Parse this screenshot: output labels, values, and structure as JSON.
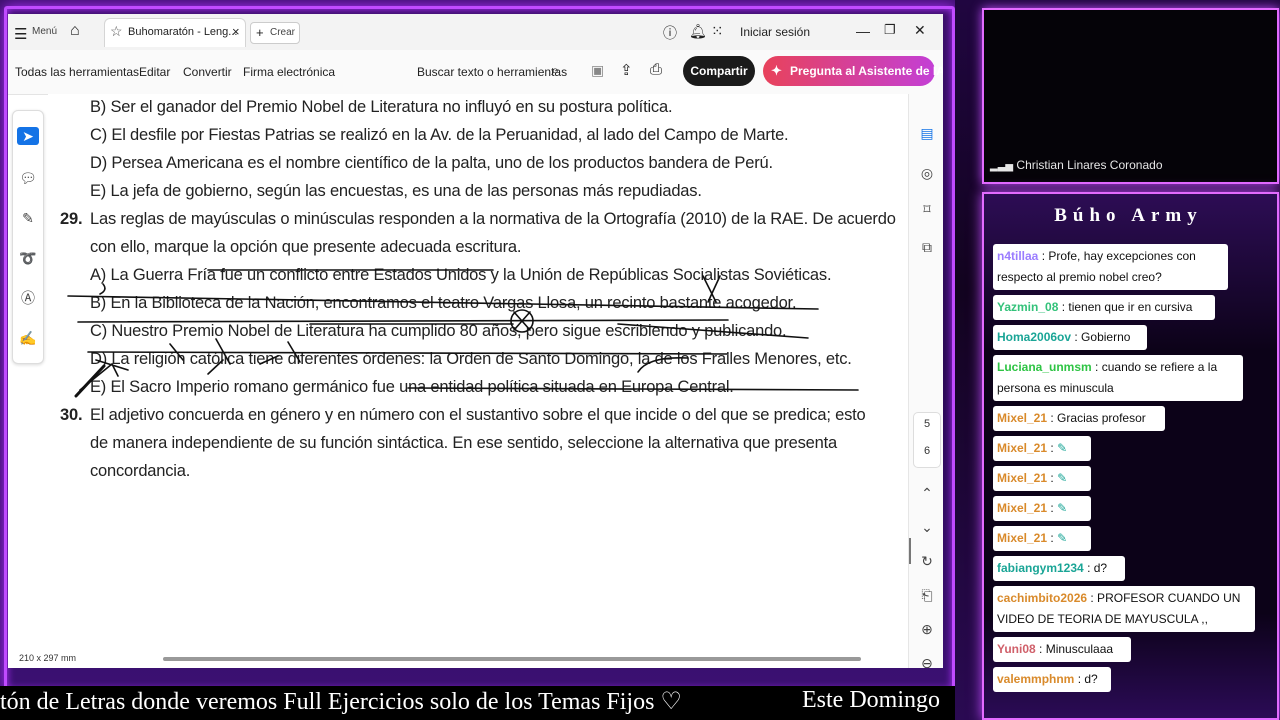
{
  "window": {
    "menu_label": "Menú",
    "tab_title": "Buhomaratón - Leng...",
    "new_label": "Crear",
    "signin_label": "Iniciar sesión"
  },
  "toolbar": {
    "all_tools": "Todas las herramientas",
    "edit": "Editar",
    "convert": "Convertir",
    "esign": "Firma electrónica",
    "search": "Buscar texto o herramientas",
    "share": "Compartir",
    "ai_assistant": "Pregunta al Asistente de IA"
  },
  "document": {
    "lines": [
      "B) Ser el ganador del Premio Nobel de Literatura no influyó en su postura política.",
      "C) El desfile por Fiestas Patrias se realizó en la Av. de la Peruanidad, al lado del Campo de Marte.",
      "D) Persea Americana es el nombre científico de la palta, uno de los productos bandera de Perú.",
      "E) La jefa de gobierno, según las encuestas, es una de las personas más repudiadas."
    ],
    "q29_num": "29.",
    "q29_line1": "Las reglas de mayúsculas o minúsculas responden a la normativa de la Ortografía (2010) de la RAE. De acuerdo",
    "q29_line2": "con ello, marque la opción que presente adecuada escritura.",
    "q29_options": [
      "A) La Guerra Fría fue un conflicto entre Estados Unidos y la Unión de Repúblicas Socialistas Soviéticas.",
      "B) En la Biblioteca de la Nación, encontramos el teatro Vargas Llosa, un recinto bastante acogedor.",
      "C) Nuestro Premio Nobel de Literatura ha cumplido 80 años, pero sigue escribiendo y publicando.",
      "D) La religión católica tiene diferentes órdenes: la Orden de Santo Domingo, la de los Frailes Menores, etc.",
      "E) El Sacro Imperio romano germánico fue una entidad política situada en Europa Central."
    ],
    "q30_num": "30.",
    "q30_line1": "El adjetivo concuerda en género y en número con el sustantivo sobre el que incide o del que se predica; esto",
    "q30_line2": "de manera independiente de su función sintáctica. En ese sentido, seleccione la alternativa que presenta",
    "q30_line3": "concordancia.",
    "page_size": "210 x 297 mm",
    "page_numbers": [
      "5",
      "6"
    ]
  },
  "ticker": {
    "left": "tón de Letras donde veremos Full Ejercicios solo de los Temas Fijos ♡",
    "right": "Este Domingo"
  },
  "stream": {
    "cam_name": "Christian Linares Coronado",
    "chat_title": "Búho Army",
    "messages": [
      {
        "user": "n4tillaa",
        "text": ": Profe, hay excepciones con respecto al premio nobel creo?",
        "color": "#9b7cff"
      },
      {
        "user": "Yazmin_08",
        "text": ": tienen que ir en cursiva",
        "color": "#33c27a"
      },
      {
        "user": "Homa2006ov",
        "text": ": Gobierno",
        "color": "#1aa596"
      },
      {
        "user": "Luciana_unmsm",
        "text": ": cuando se refiere a la persona es minuscula",
        "color": "#2ec444"
      },
      {
        "user": "Mixel_21",
        "text": ": Gracias profesor",
        "color": "#d98a2b"
      },
      {
        "user": "Mixel_21",
        "text": ":",
        "color": "#d98a2b"
      },
      {
        "user": "Mixel_21",
        "text": ":",
        "color": "#d98a2b"
      },
      {
        "user": "Mixel_21",
        "text": ":",
        "color": "#d98a2b"
      },
      {
        "user": "Mixel_21",
        "text": ":",
        "color": "#d98a2b"
      },
      {
        "user": "fabiangym1234",
        "text": ": d?",
        "color": "#1aa596"
      },
      {
        "user": "cachimbito2026",
        "text": ": PROFESOR CUANDO UN VIDEO DE TEORIA DE MAYUSCULA ,,",
        "color": "#d98a2b"
      },
      {
        "user": "Yuni08",
        "text": ": Minusculaaa",
        "color": "#d0606a"
      },
      {
        "user": "valemmphnm",
        "text": ": d?",
        "color": "#d98a2b"
      }
    ]
  }
}
